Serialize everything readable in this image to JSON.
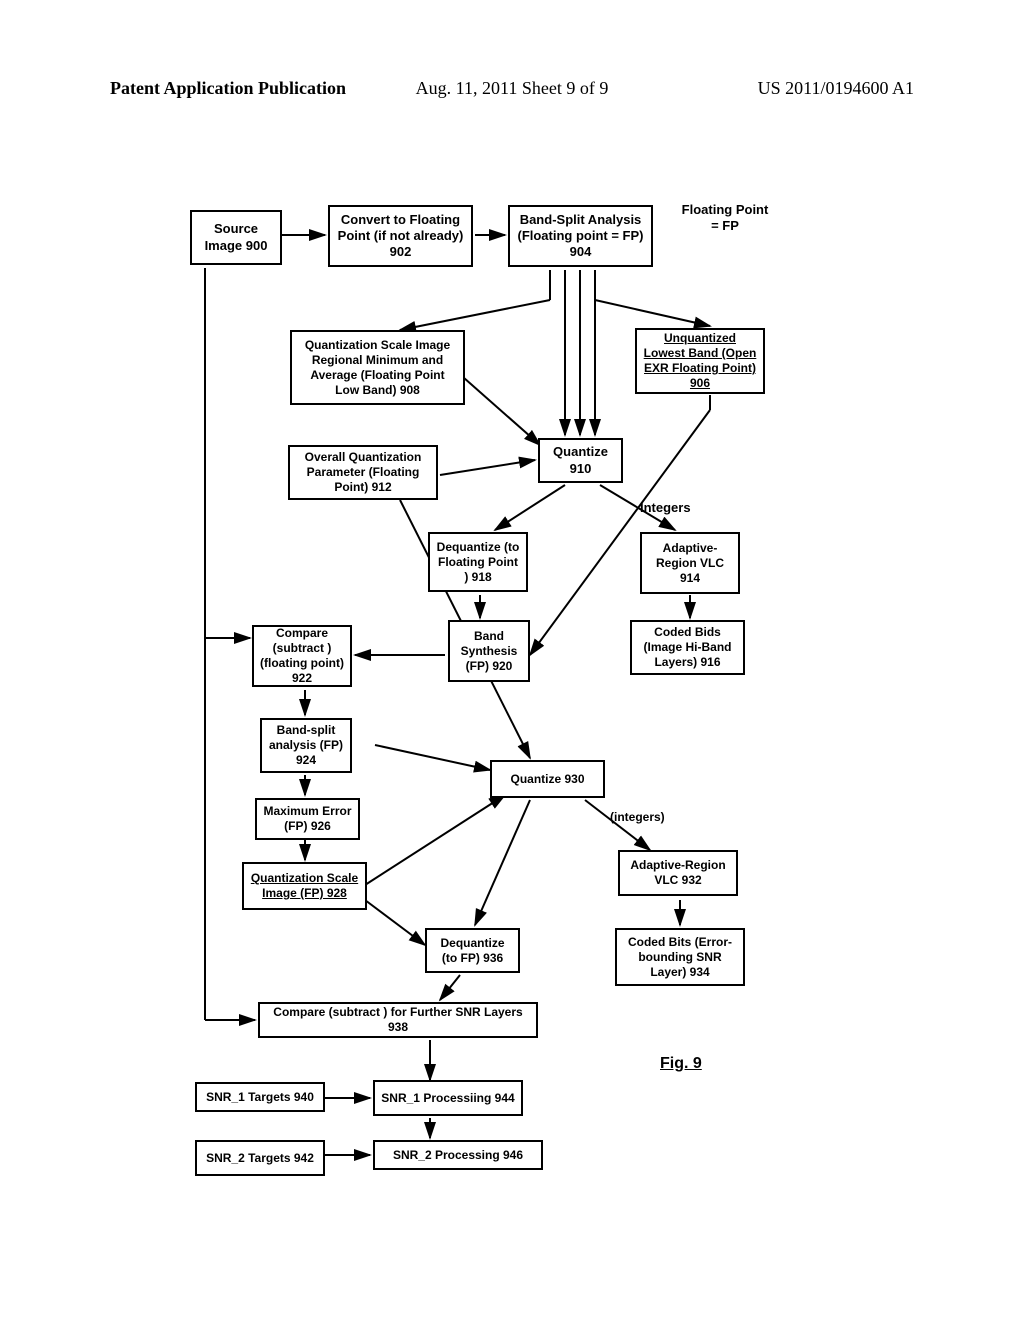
{
  "header": {
    "left": "Patent Application Publication",
    "center": "Aug. 11, 2011  Sheet 9 of 9",
    "right": "US 2011/0194600 A1"
  },
  "labels": {
    "fp_header": "Floating Point = FP",
    "integers": "Integers",
    "integers2": "(integers)",
    "fig": "Fig. 9"
  },
  "boxes": {
    "source": "Source Image 900",
    "convert": "Convert to Floating Point (if not already) 902",
    "bandsplit": "Band-Split Analysis (Floating point = FP) 904",
    "qscale": "Quantization Scale Image Regional Minimum and Average (Floating Point Low Band) 908",
    "unquant": "Unquantized Lowest Band (Open EXR Floating Point) 906",
    "overallq": "Overall Quantization Parameter (Floating Point) 912",
    "quantize": "Quantize 910",
    "dequant": "Dequantize (to Floating Point ) 918",
    "arvlc": "Adaptive-Region VLC 914",
    "compare": "Compare (subtract )(floating point) 922",
    "bandsynth": "Band Synthesis (FP) 920",
    "codedbits": "Coded Bids (Image Hi-Band Layers) 916",
    "bandsplit2": "Band-split analysis (FP) 924",
    "quantize2": "Quantize 930",
    "maxerr": "Maximum Error (FP) 926",
    "arvlc2": "Adaptive-Region VLC 932",
    "qscale2": "Quantization Scale Image (FP) 928",
    "dequant2": "Dequantize (to FP) 936",
    "codedbits2": "Coded Bits (Error-bounding SNR Layer) 934",
    "compare2": "Compare (subtract ) for Further SNR Layers 938",
    "snr1t": "SNR_1 Targets 940",
    "snr1p": "SNR_1 Processiing 944",
    "snr2t": "SNR_2 Targets 942",
    "snr2p": "SNR_2 Processing 946"
  }
}
